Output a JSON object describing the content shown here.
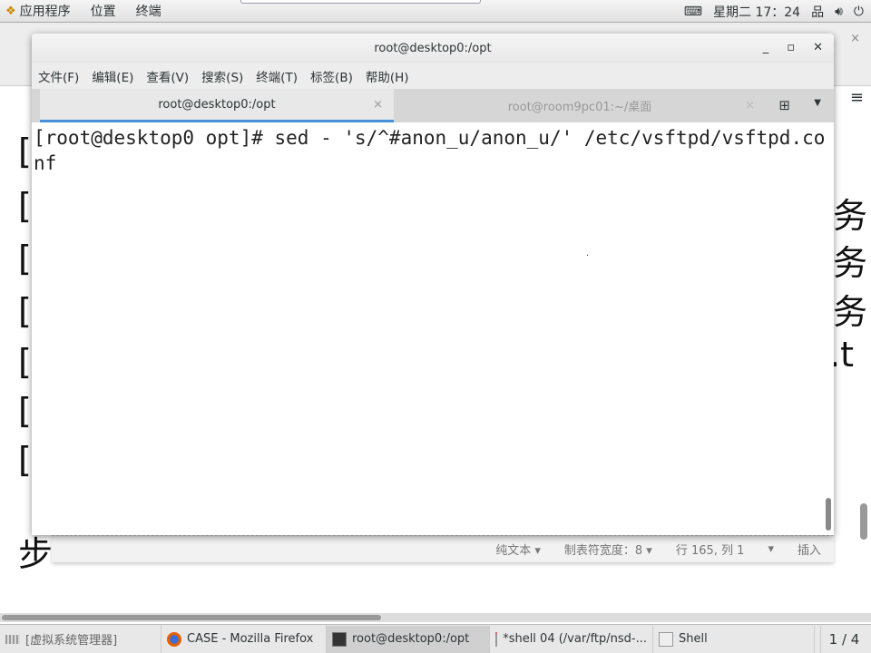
{
  "topbar": {
    "menus": [
      "应用程序",
      "位置",
      "终端"
    ],
    "clock": "星期二 17：24"
  },
  "background": {
    "chars_left": [
      "[",
      "[",
      "[",
      "[",
      "[",
      "[",
      "["
    ],
    "chars_right": [
      "务",
      "务",
      "务",
      ".t"
    ],
    "bottom_char": "步"
  },
  "terminal": {
    "title": "root@desktop0:/opt",
    "menu": [
      "文件(F)",
      "编辑(E)",
      "查看(V)",
      "搜索(S)",
      "终端(T)",
      "标签(B)",
      "帮助(H)"
    ],
    "tabs": [
      {
        "label": "root@desktop0:/opt",
        "active": true
      },
      {
        "label": "root@room9pc01:~/桌面",
        "active": false
      }
    ],
    "content": "[root@desktop0 opt]# sed - 's/^#anon_u/anon_u/' /etc/vsftpd/vsftpd.conf"
  },
  "editor_status": {
    "syntax": "纯文本 ▾",
    "tab_width": "制表符宽度：8 ▾",
    "position": "行 165, 列 1",
    "dropdown": "▾",
    "mode": "插入"
  },
  "taskbar": {
    "items": [
      "[虚拟系统管理器]",
      "CASE - Mozilla Firefox",
      "root@desktop0:/opt",
      "*shell 04 (/var/ftp/nsd-...",
      "Shell"
    ],
    "pager": "1 / 4"
  }
}
